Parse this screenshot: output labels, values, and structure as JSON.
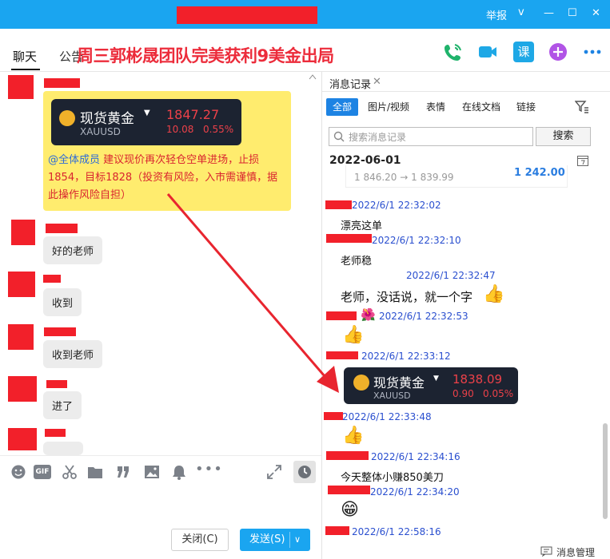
{
  "window": {
    "report_label": "举报",
    "controls": [
      "v",
      "—",
      "☐",
      "✕"
    ]
  },
  "header": {
    "tabs": [
      {
        "label": "聊天"
      },
      {
        "label": "公告"
      }
    ],
    "banner": "周三郭彬晟团队完美获利9美金出局",
    "icons": [
      "phone-icon",
      "video-icon",
      "course-icon",
      "plus-icon",
      "more-icon"
    ],
    "course_label": "课"
  },
  "chat": {
    "gold_card": {
      "title": "现货黄金",
      "symbol": "XAUUSD",
      "price": "1847.27",
      "change": "10.08",
      "change_pct": "0.55%"
    },
    "notice_at": "@全体成员",
    "notice_text": " 建议现价再次轻仓空单进场，止损1854，目标1828（投资有风险，入市需谨慎，据此操作风险自担）",
    "messages": [
      {
        "text": "好的老师"
      },
      {
        "text": "收到"
      },
      {
        "text": "收到老师"
      },
      {
        "text": "进了"
      }
    ]
  },
  "toolbar": {
    "icons": [
      "emoji-icon",
      "gif-icon",
      "scissors-icon",
      "folder-icon",
      "quote-icon",
      "image-icon",
      "bell-icon",
      "more-dots-icon",
      "expand-icon",
      "history-icon"
    ],
    "gif_label": "GIF"
  },
  "composer": {
    "close_label": "关闭(C)",
    "send_label": "发送(S)"
  },
  "history": {
    "tab_title": "消息记录",
    "filters": [
      "全部",
      "图片/视频",
      "表情",
      "在线文档",
      "链接"
    ],
    "search_placeholder": "搜索消息记录",
    "search_button": "搜索",
    "date": "2022-06-01",
    "partial_card": {
      "from_to": "1 846.20 → 1 839.99",
      "value": "1 242.00"
    },
    "items": [
      {
        "time": "2022/6/1 22:32:02",
        "text": "漂亮这单"
      },
      {
        "time": "2022/6/1 22:32:10",
        "text": "老师稳"
      },
      {
        "time": "2022/6/1 22:32:47",
        "text": "老师，没话说，就一个字"
      },
      {
        "time": "2022/6/1 22:32:53",
        "text": ""
      },
      {
        "time": "2022/6/1 22:33:12",
        "text": ""
      },
      {
        "time": "2022/6/1 22:33:48",
        "text": ""
      },
      {
        "time": "2022/6/1 22:34:16",
        "text": "今天整体小赚850美刀"
      },
      {
        "time": "2022/6/1 22:34:20",
        "text": ""
      },
      {
        "time": "2022/6/1 22:58:16",
        "text": ""
      }
    ],
    "gold_card": {
      "title": "现货黄金",
      "symbol": "XAUUSD",
      "price": "1838.09",
      "change": "0.90",
      "change_pct": "0.05%"
    },
    "manage_label": "消息管理"
  },
  "colors": {
    "titlebar": "#1aa5f0",
    "redact": "#f2202a",
    "accent": "#1d83e3",
    "highlight": "#ffec6e"
  }
}
